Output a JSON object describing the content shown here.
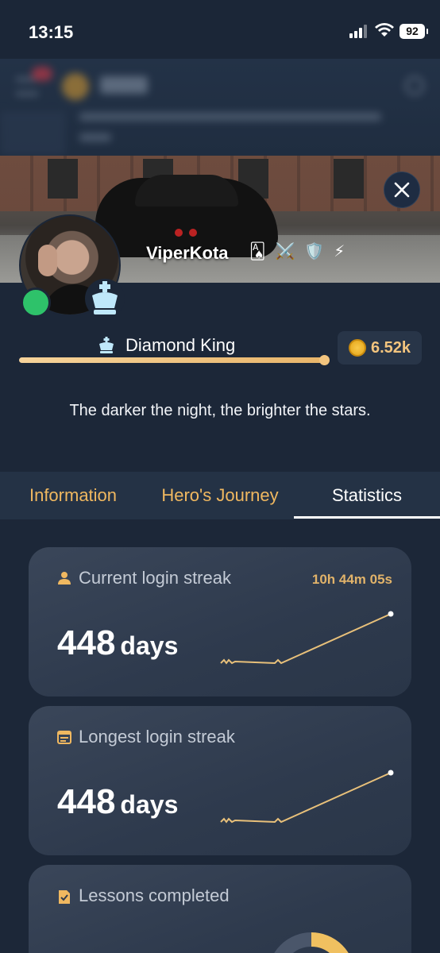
{
  "status_bar": {
    "time": "13:15",
    "battery": "92"
  },
  "profile": {
    "username": "ViperKota",
    "user_icons": [
      "🂡",
      "⚔️",
      "🛡️",
      "⚡"
    ],
    "rank": "Diamond King",
    "rank_progress": 0.99,
    "coins": "6.52k",
    "bio": "The darker the night, the brighter the stars."
  },
  "tabs": [
    {
      "label": "Information",
      "active": false
    },
    {
      "label": "Hero's Journey",
      "active": false
    },
    {
      "label": "Statistics",
      "active": true
    }
  ],
  "stats": {
    "current_streak": {
      "title": "Current login streak",
      "timer": "10h 44m 05s",
      "value": "448",
      "unit": "days",
      "icon": "person-icon"
    },
    "longest_streak": {
      "title": "Longest login streak",
      "value": "448",
      "unit": "days",
      "icon": "calendar-icon"
    },
    "lessons": {
      "title": "Lessons completed",
      "icon": "lesson-icon"
    }
  },
  "colors": {
    "background": "#1c2738",
    "accent_gold": "#f0b860",
    "online": "#2ec26a",
    "card": "#344156"
  }
}
